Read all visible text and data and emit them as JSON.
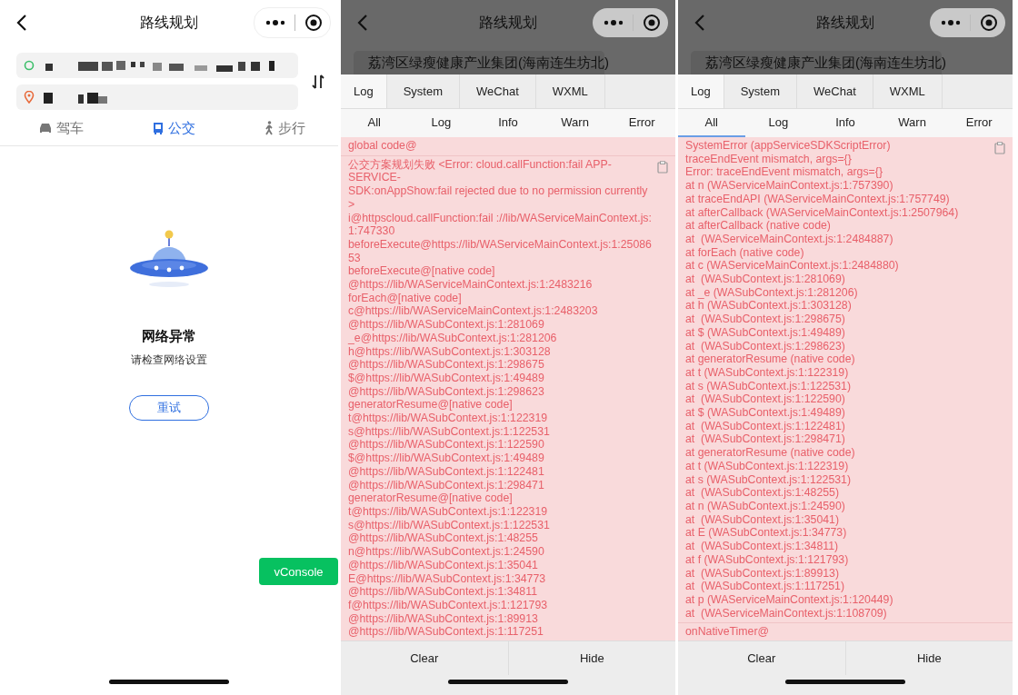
{
  "route_screen": {
    "title": "路线规划",
    "fields": [
      {
        "kind": "start"
      },
      {
        "kind": "end"
      }
    ],
    "tabs": [
      {
        "label": "驾车",
        "kind": "car",
        "selected": false
      },
      {
        "label": "公交",
        "kind": "bus",
        "selected": true
      },
      {
        "label": "步行",
        "kind": "walk",
        "selected": false
      }
    ],
    "error": {
      "title": "网络异常",
      "message": "请检查网络设置",
      "button": "重试"
    },
    "floating_button": "vConsole"
  },
  "console_screens": [
    {
      "title": "路线规划",
      "start_address": "荔湾区绿瘦健康产业集团(海南连生坊北)",
      "tabs": [
        {
          "label": "Log",
          "selected": true
        },
        {
          "label": "System",
          "selected": false
        },
        {
          "label": "WeChat",
          "selected": false
        },
        {
          "label": "WXML",
          "selected": false
        }
      ],
      "filters": [
        {
          "label": "All",
          "selected": false
        },
        {
          "label": "Log",
          "selected": false
        },
        {
          "label": "Info",
          "selected": false
        },
        {
          "label": "Warn",
          "selected": false
        },
        {
          "label": "Error",
          "selected": false
        }
      ],
      "entries": [
        {
          "copy_button": false,
          "lines": [
            "global code@"
          ]
        },
        {
          "copy_button": true,
          "lines": [
            "公交方案规划失败 <Error: cloud.callFunction:fail APP-",
            "SERVICE-",
            "SDK:onAppShow:fail rejected due to no permission currently",
            ">",
            "i@httpscloud.callFunction:fail ://lib/WAServiceMainContext.js:",
            "1:747330",
            "beforeExecute@https://lib/WAServiceMainContext.js:1:25086",
            "53",
            "beforeExecute@[native code]",
            "@https://lib/WAServiceMainContext.js:1:2483216",
            "forEach@[native code]",
            "c@https://lib/WAServiceMainContext.js:1:2483203",
            "@https://lib/WASubContext.js:1:281069",
            "_e@https://lib/WASubContext.js:1:281206",
            "h@https://lib/WASubContext.js:1:303128",
            "@https://lib/WASubContext.js:1:298675",
            "$@https://lib/WASubContext.js:1:49489",
            "@https://lib/WASubContext.js:1:298623",
            "generatorResume@[native code]",
            "t@https://lib/WASubContext.js:1:122319",
            "s@https://lib/WASubContext.js:1:122531",
            "@https://lib/WASubContext.js:1:122590",
            "$@https://lib/WASubContext.js:1:49489",
            "@https://lib/WASubContext.js:1:122481",
            "@https://lib/WASubContext.js:1:298471",
            "generatorResume@[native code]",
            "t@https://lib/WASubContext.js:1:122319",
            "s@https://lib/WASubContext.js:1:122531",
            "@https://lib/WASubContext.js:1:48255",
            "n@https://lib/WASubContext.js:1:24590",
            "@https://lib/WASubContext.js:1:35041",
            "E@https://lib/WASubContext.js:1:34773",
            "@https://lib/WASubContext.js:1:34811",
            "f@https://lib/WASubContext.js:1:121793",
            "@https://lib/WASubContext.js:1:89913",
            "@https://lib/WASubContext.js:1:117251"
          ]
        }
      ],
      "footer": [
        "Clear",
        "Hide"
      ]
    },
    {
      "title": "路线规划",
      "start_address": "荔湾区绿瘦健康产业集团(海南连生坊北)",
      "tabs": [
        {
          "label": "Log",
          "selected": true
        },
        {
          "label": "System",
          "selected": false
        },
        {
          "label": "WeChat",
          "selected": false
        },
        {
          "label": "WXML",
          "selected": false
        }
      ],
      "filters": [
        {
          "label": "All",
          "selected": true
        },
        {
          "label": "Log",
          "selected": false
        },
        {
          "label": "Info",
          "selected": false
        },
        {
          "label": "Warn",
          "selected": false
        },
        {
          "label": "Error",
          "selected": false
        }
      ],
      "entries": [
        {
          "copy_button": true,
          "lines": [
            "SystemError (appServiceSDKScriptError)",
            "traceEndEvent mismatch, args={}",
            "Error: traceEndEvent mismatch, args={}",
            "at n (WAServiceMainContext.js:1:757390)",
            "at traceEndAPI (WAServiceMainContext.js:1:757749)",
            "at afterCallback (WAServiceMainContext.js:1:2507964)",
            "at afterCallback (native code)",
            "at  (WAServiceMainContext.js:1:2484887)",
            "at forEach (native code)",
            "at c (WAServiceMainContext.js:1:2484880)",
            "at  (WASubContext.js:1:281069)",
            "at _e (WASubContext.js:1:281206)",
            "at h (WASubContext.js:1:303128)",
            "at  (WASubContext.js:1:298675)",
            "at $ (WASubContext.js:1:49489)",
            "at  (WASubContext.js:1:298623)",
            "at generatorResume (native code)",
            "at t (WASubContext.js:1:122319)",
            "at s (WASubContext.js:1:122531)",
            "at  (WASubContext.js:1:122590)",
            "at $ (WASubContext.js:1:49489)",
            "at  (WASubContext.js:1:122481)",
            "at  (WASubContext.js:1:298471)",
            "at generatorResume (native code)",
            "at t (WASubContext.js:1:122319)",
            "at s (WASubContext.js:1:122531)",
            "at  (WASubContext.js:1:48255)",
            "at n (WASubContext.js:1:24590)",
            "at  (WASubContext.js:1:35041)",
            "at E (WASubContext.js:1:34773)",
            "at  (WASubContext.js:1:34811)",
            "at f (WASubContext.js:1:121793)",
            "at  (WASubContext.js:1:89913)",
            "at  (WASubContext.js:1:117251)",
            "at p (WAServiceMainContext.js:1:120449)",
            "at  (WAServiceMainContext.js:1:108709)"
          ]
        },
        {
          "copy_button": false,
          "lines": [
            "onNativeTimer@"
          ]
        }
      ],
      "footer": [
        "Clear",
        "Hide"
      ]
    }
  ]
}
